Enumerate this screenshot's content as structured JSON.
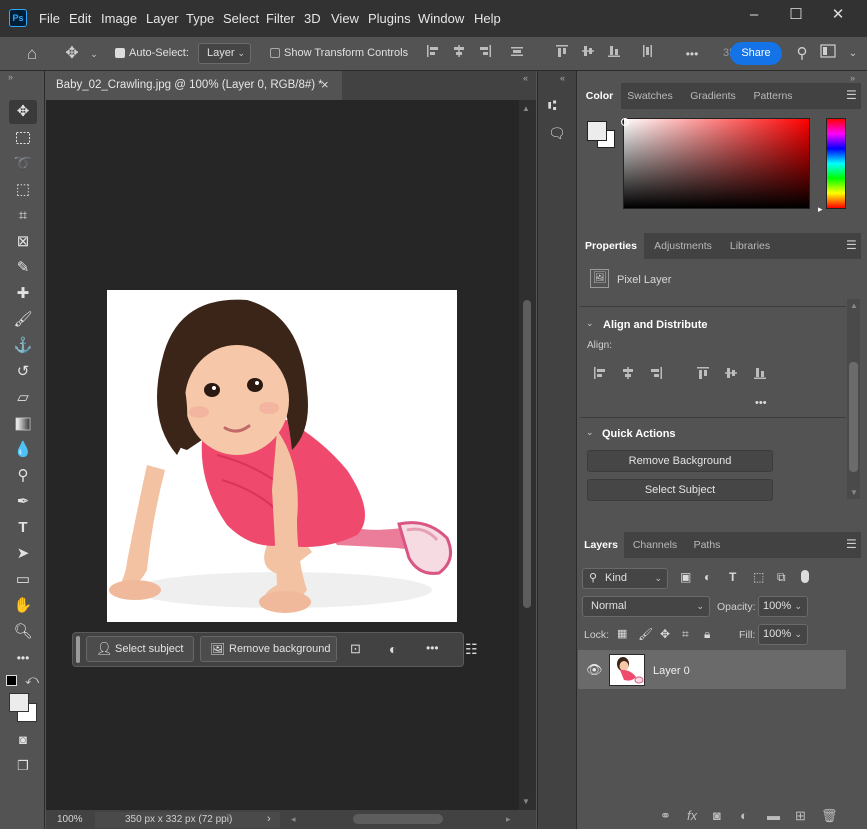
{
  "menubar": {
    "app_logo": "Ps",
    "items": [
      "File",
      "Edit",
      "Image",
      "Layer",
      "Type",
      "Select",
      "Filter",
      "3D",
      "View",
      "Plugins",
      "Window",
      "Help"
    ],
    "window_controls": [
      "–",
      "☐",
      "✕"
    ]
  },
  "options_bar": {
    "auto_select_label": "Auto-Select:",
    "auto_select_target": "Layer",
    "show_transform_label": "Show Transform Controls",
    "three_d_label": "3D",
    "share_label": "Share"
  },
  "document": {
    "tab_title": "Baby_02_Crawling.jpg @ 100% (Layer 0, RGB/8#) *",
    "close_glyph": "×",
    "zoom": "100%",
    "dimensions": "350 px x 332 px (72 ppi)"
  },
  "task_bar": {
    "select_subject": "Select subject",
    "remove_background": "Remove background",
    "more": "•••"
  },
  "color_panel": {
    "tabs": [
      "Color",
      "Swatches",
      "Gradients",
      "Patterns"
    ],
    "hue": "#ff0000"
  },
  "properties_panel": {
    "tabs": [
      "Properties",
      "Adjustments",
      "Libraries"
    ],
    "layer_type": "Pixel Layer",
    "align_section": "Align and Distribute",
    "align_label": "Align:",
    "more": "•••",
    "quick_actions_section": "Quick Actions",
    "remove_background_btn": "Remove Background",
    "select_subject_btn": "Select Subject"
  },
  "layers_panel": {
    "tabs": [
      "Layers",
      "Channels",
      "Paths"
    ],
    "filter_kind": "Kind",
    "blend_mode": "Normal",
    "opacity_label": "Opacity:",
    "opacity_value": "100%",
    "lock_label": "Lock:",
    "fill_label": "Fill:",
    "fill_value": "100%",
    "layers": [
      {
        "name": "Layer 0",
        "visible": true
      }
    ]
  },
  "colors": {
    "accent": "#1473e6",
    "foreground": "#ececec",
    "background": "#ffffff"
  }
}
